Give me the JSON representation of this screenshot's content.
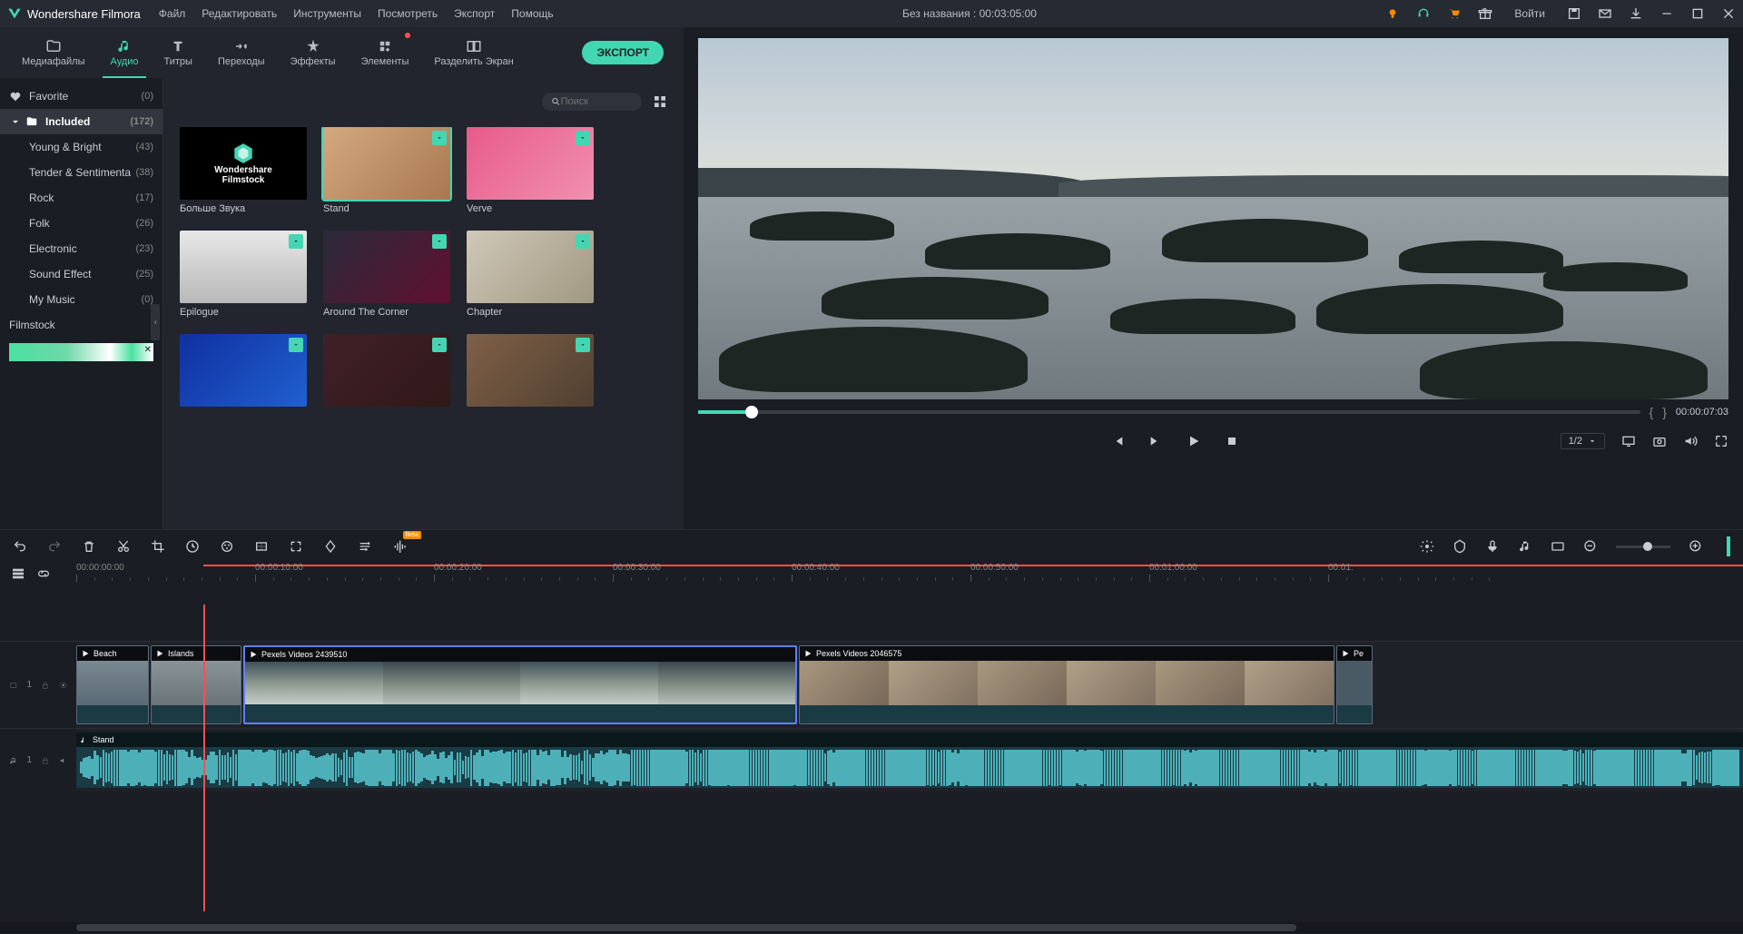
{
  "titlebar": {
    "app_name": "Wondershare Filmora",
    "menus": [
      "Файл",
      "Редактировать",
      "Инструменты",
      "Посмотреть",
      "Экспорт",
      "Помощь"
    ],
    "project_title": "Без названия : 00:03:05:00",
    "login": "Войти"
  },
  "tabs": [
    {
      "label": "Медиафайлы"
    },
    {
      "label": "Аудио"
    },
    {
      "label": "Титры"
    },
    {
      "label": "Переходы"
    },
    {
      "label": "Эффекты"
    },
    {
      "label": "Элементы"
    },
    {
      "label": "Разделить Экран"
    }
  ],
  "export_btn": "ЭКСПОРТ",
  "sidebar": {
    "favorite": {
      "label": "Favorite",
      "count": "(0)"
    },
    "included": {
      "label": "Included",
      "count": "(172)"
    },
    "children": [
      {
        "label": "Young & Bright",
        "count": "(43)"
      },
      {
        "label": "Tender & Sentimenta",
        "count": "(38)"
      },
      {
        "label": "Rock",
        "count": "(17)"
      },
      {
        "label": "Folk",
        "count": "(26)"
      },
      {
        "label": "Electronic",
        "count": "(23)"
      },
      {
        "label": "Sound Effect",
        "count": "(25)"
      },
      {
        "label": "My Music",
        "count": "(0)"
      }
    ],
    "filmstock": {
      "label": "Filmstock"
    }
  },
  "search": {
    "placeholder": "Поиск"
  },
  "media_grid": [
    {
      "name": "Больше Звука",
      "filmstock_top": "Wondershare",
      "filmstock_bottom": "Filmstock"
    },
    {
      "name": "Stand",
      "selected": true
    },
    {
      "name": "Verve"
    },
    {
      "name": "Epilogue"
    },
    {
      "name": "Around The Corner"
    },
    {
      "name": "Chapter"
    },
    {
      "name": ""
    },
    {
      "name": ""
    },
    {
      "name": ""
    }
  ],
  "preview": {
    "time": "00:00:07:03",
    "ratio": "1/2"
  },
  "ruler": {
    "labels": [
      "00:00:00:00",
      "00:00:10:00",
      "00:00:20:00",
      "00:00:30:00",
      "00:00:40:00",
      "00:00:50:00",
      "00:01:00:00",
      "00:01:"
    ]
  },
  "tracks": {
    "video_label": "1",
    "audio_label": "1"
  },
  "clips": {
    "v1": "Beach",
    "v2": "Islands",
    "v3": "Pexels Videos 2439510",
    "v4": "Pexels Videos 2046575",
    "v5": "Pe",
    "audio": "Stand"
  },
  "beta": "Beta"
}
